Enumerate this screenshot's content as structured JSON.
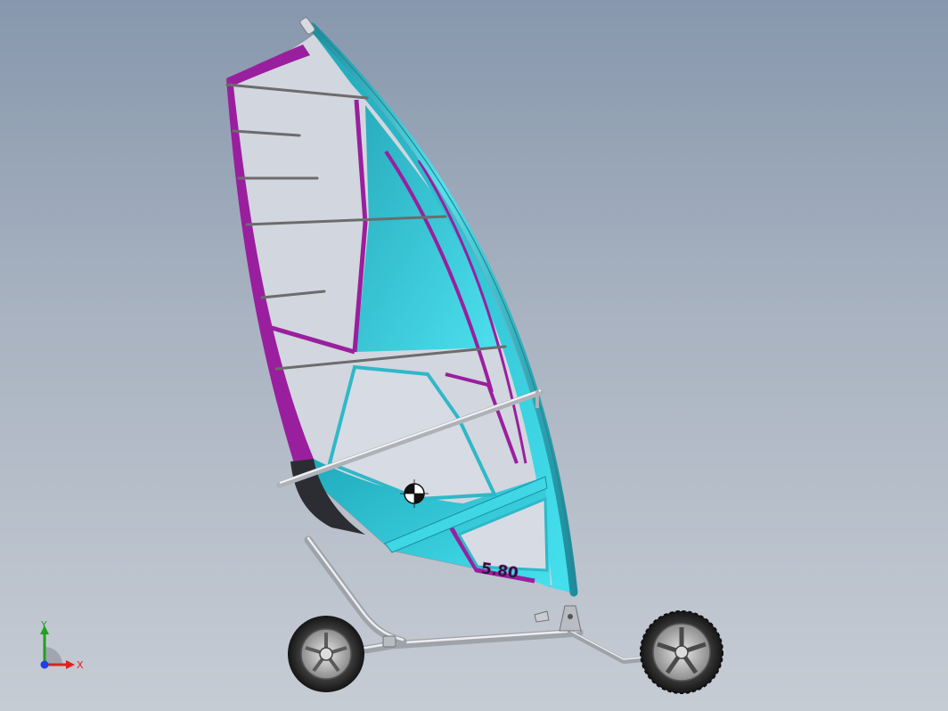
{
  "viewport": {
    "background_top": "#8797ad",
    "background_bottom": "#c6ccd4"
  },
  "model": {
    "sail_size_label": "5.80",
    "colors": {
      "cyan": "#2fb8c8",
      "cyan_light": "#3fd6e6",
      "magenta": "#9a1f9e",
      "panel": "#d3d7df",
      "metal": "#c8ccd0",
      "tire": "#2a2a2a"
    }
  },
  "triad": {
    "x_label": "X",
    "y_label": "Y",
    "x_color": "#e02020",
    "y_color": "#20a020",
    "z_color": "#2040e0"
  },
  "icons": {
    "center_of_mass": "center-of-mass-icon"
  }
}
